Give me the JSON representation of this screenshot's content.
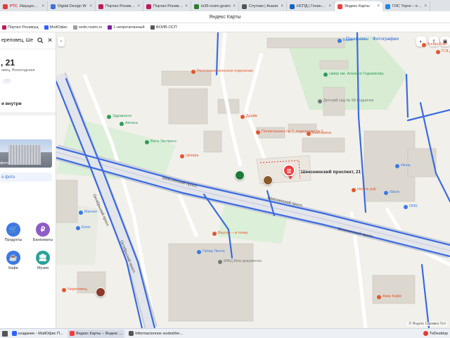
{
  "browser": {
    "tabs": [
      {
        "label": "Имущество",
        "color": "#e53935",
        "prefix": "РТС"
      },
      {
        "label": "Digital Design W",
        "color": "#3f6fd8"
      },
      {
        "label": "Портал Росимущ",
        "color": "#c2185b"
      },
      {
        "label": "Портал Росимущ",
        "color": "#c2185b"
      },
      {
        "label": "ts35-rosim.gosim",
        "color": "#2e7d32"
      },
      {
        "label": "Спутник | Анали",
        "color": "#555555"
      },
      {
        "label": "НСПД | Геоинфо",
        "color": "#1565c0"
      },
      {
        "label": "Яндекс Карты",
        "color": "#f23b3b",
        "active": true
      },
      {
        "label": "ГИС Торги – прод",
        "color": "#1e88e5"
      }
    ],
    "page_title": "Яндекс Карты",
    "bookmarks": [
      {
        "label": "Портал Росимущ",
        "color": "#c2185b"
      },
      {
        "label": "МойОфис",
        "color": "#2962ff"
      },
      {
        "label": "sedo.rosim.ru",
        "color": "#9e9e9e"
      },
      {
        "label": "1 непрочитанный",
        "color": "#7b1fa2"
      },
      {
        "label": "ФОИВ-ОСП",
        "color": "#555555"
      }
    ]
  },
  "panel": {
    "search_value": "ереповец, Ше",
    "title": ", 21",
    "subtitle": "овец, Вологодская",
    "more": "···",
    "inside_label": "и внутри",
    "photo_label": "фото",
    "add_photo": "о фото",
    "categories": [
      {
        "label": "Продукты",
        "color": "#3b78e7",
        "glyph": "🛒"
      },
      {
        "label": "Банкоматы",
        "color": "#8e5bc9",
        "glyph": "₽"
      },
      {
        "label": "Кафе",
        "color": "#3b78e7",
        "glyph": "☕"
      },
      {
        "label": "Музеи",
        "color": "#2aa198",
        "glyph": "🏛"
      }
    ]
  },
  "map": {
    "panorama_label": "Панорамы",
    "photos_label": "Фотографии",
    "pin_label": "Шекснинский проспект, 21",
    "attribution": "© Яндекс Справка Усл",
    "roads": [
      {
        "label": "Шекснинский просп."
      },
      {
        "label": "Шекснинский просп."
      },
      {
        "label": "Шекснинский просп."
      },
      {
        "label": "Октябрьский просп."
      },
      {
        "label": "Октябрьский просп."
      }
    ],
    "places": [
      {
        "label": "Рентгенологическое отделение",
        "color": "#e4572e"
      },
      {
        "label": "Здравсити",
        "color": "#2e9e5b"
      },
      {
        "label": "Аптека",
        "color": "#2e9e5b"
      },
      {
        "label": "Вита Экспресс",
        "color": "#2e9e5b"
      },
      {
        "label": "Цезарь",
        "color": "#e4572e"
      },
      {
        "label": "Поликлиника № 7, отделение № 2",
        "color": "#e4572e"
      },
      {
        "label": "Викторина",
        "color": "#e4572e"
      },
      {
        "label": "Детский сад № 98 Родничок",
        "color": "#777777"
      },
      {
        "label": "сквер им. Алексея Годовикова",
        "color": "#2e9e5b"
      },
      {
        "label": "Магнит",
        "color": "#3b78e7"
      },
      {
        "label": "Епох",
        "color": "#3b78e7"
      },
      {
        "label": "Вкусно – и точка",
        "color": "#e4572e"
      },
      {
        "label": "Гипер Лента",
        "color": "#3b78e7"
      },
      {
        "label": "МФЦ Мои документы",
        "color": "#777777"
      },
      {
        "label": "Череповец",
        "color": "#e4572e"
      },
      {
        "label": "iStore",
        "color": "#3b78e7"
      },
      {
        "label": "Июнь",
        "color": "#3b78e7"
      },
      {
        "label": "DNS",
        "color": "#3b78e7"
      },
      {
        "label": "Аква Кафе",
        "color": "#e4572e"
      },
      {
        "label": "Кэнди-Бар",
        "color": "#e4572e"
      },
      {
        "label": "Карат",
        "color": "#3b78e7"
      },
      {
        "label": "Hearts pub",
        "color": "#e4572e"
      },
      {
        "label": "П.Я.Дмитриева",
        "color": "#e4572e"
      },
      {
        "label": "Драйв",
        "color": "#e4572e"
      }
    ]
  },
  "taskbar": {
    "items": [
      {
        "label": "коздание - МойОфис П...",
        "color": "#2962ff"
      },
      {
        "label": "Яндекс Карты – Яндекс ...",
        "color": "#f23b3b",
        "active": true
      },
      {
        "label": "Informacionnoe soobshhe...",
        "color": "#555555"
      }
    ],
    "tray_label": "ToDesktop"
  }
}
